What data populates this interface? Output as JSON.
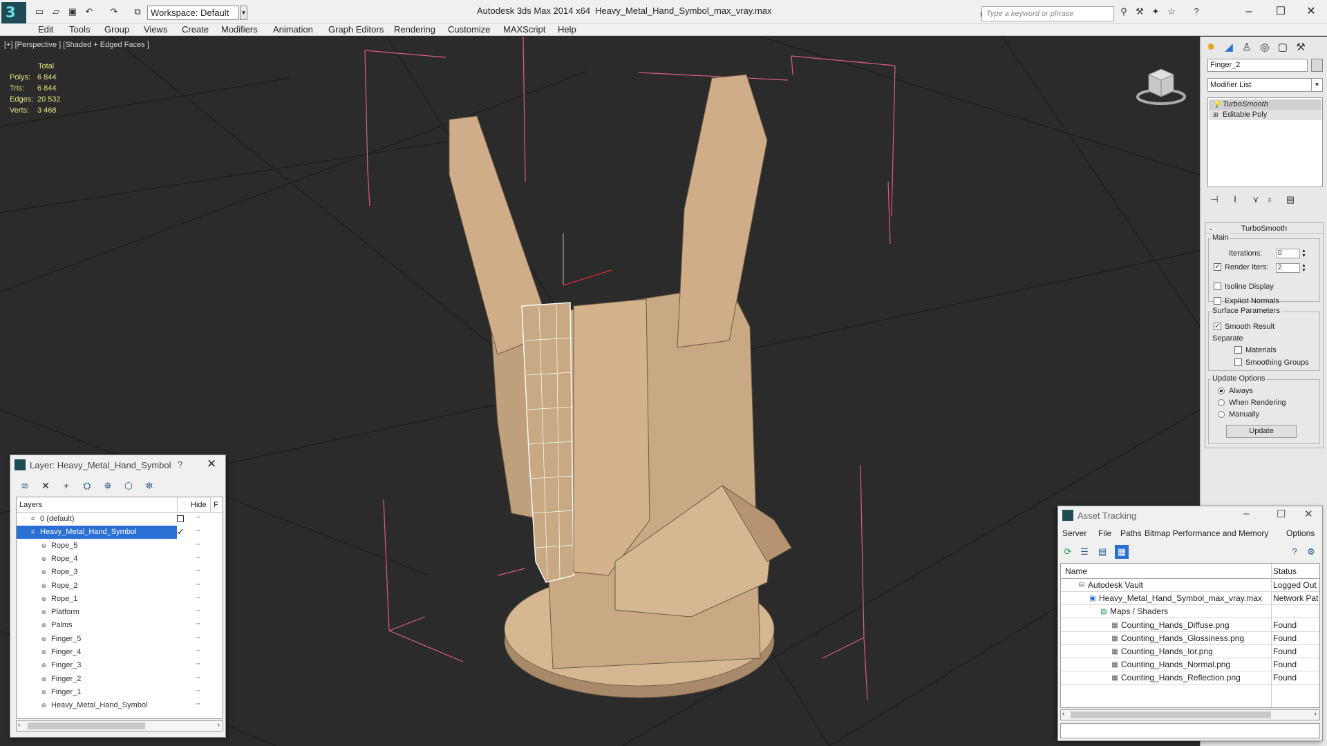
{
  "titlebar": {
    "workspace": "Workspace: Default",
    "app_title": "Autodesk 3ds Max  2014 x64",
    "file_title": "Heavy_Metal_Hand_Symbol_max_vray.max",
    "search_placeholder": "Type a keyword or phrase"
  },
  "menu": [
    "Edit",
    "Tools",
    "Group",
    "Views",
    "Create",
    "Modifiers",
    "Animation",
    "Graph Editors",
    "Rendering",
    "Customize",
    "MAXScript",
    "Help"
  ],
  "viewport": {
    "label": "[+] [Perspective ] [Shaded + Edged Faces ]",
    "stats": {
      "header": "Total",
      "rows": [
        {
          "label": "Polys:",
          "value": "6 844"
        },
        {
          "label": "Tris:",
          "value": "6 844"
        },
        {
          "label": "Edges:",
          "value": "20 532"
        },
        {
          "label": "Verts:",
          "value": "3 468"
        }
      ]
    }
  },
  "command_panel": {
    "object_name": "Finger_2",
    "modifier_list": "Modifier List",
    "stack": [
      "TurboSmooth",
      "Editable Poly"
    ],
    "rollout": {
      "title": "TurboSmooth",
      "main_group": "Main",
      "iterations_label": "Iterations:",
      "iterations_value": "0",
      "render_iters_label": "Render Iters:",
      "render_iters_value": "2",
      "render_iters_checked": true,
      "isoline_label": "Isoline Display",
      "explicit_label": "Explicit Normals",
      "surface_group": "Surface Parameters",
      "smooth_result_label": "Smooth Result",
      "separate_label": "Separate",
      "materials_label": "Materials",
      "smoothing_groups_label": "Smoothing Groups",
      "update_group": "Update Options",
      "always_label": "Always",
      "when_rendering_label": "When Rendering",
      "manually_label": "Manually",
      "update_button": "Update"
    }
  },
  "layer_panel": {
    "title": "Layer: Heavy_Metal_Hand_Symbol",
    "help": "?",
    "col_layers": "Layers",
    "col_hide": "Hide",
    "col_f": "F",
    "rows": [
      {
        "name": "0 (default)",
        "selected": false,
        "indent": 1
      },
      {
        "name": "Heavy_Metal_Hand_Symbol",
        "selected": true,
        "indent": 1
      },
      {
        "name": "Rope_5",
        "selected": false,
        "indent": 2
      },
      {
        "name": "Rope_4",
        "selected": false,
        "indent": 2
      },
      {
        "name": "Rope_3",
        "selected": false,
        "indent": 2
      },
      {
        "name": "Rope_2",
        "selected": false,
        "indent": 2
      },
      {
        "name": "Rope_1",
        "selected": false,
        "indent": 2
      },
      {
        "name": "Platform",
        "selected": false,
        "indent": 2
      },
      {
        "name": "Palms",
        "selected": false,
        "indent": 2
      },
      {
        "name": "Finger_5",
        "selected": false,
        "indent": 2
      },
      {
        "name": "Finger_4",
        "selected": false,
        "indent": 2
      },
      {
        "name": "Finger_3",
        "selected": false,
        "indent": 2
      },
      {
        "name": "Finger_2",
        "selected": false,
        "indent": 2
      },
      {
        "name": "Finger_1",
        "selected": false,
        "indent": 2
      },
      {
        "name": "Heavy_Metal_Hand_Symbol",
        "selected": false,
        "indent": 2
      }
    ]
  },
  "asset_tracking": {
    "title": "Asset Tracking",
    "menu": [
      "Server",
      "File",
      "Paths",
      "Bitmap Performance and Memory",
      "Options"
    ],
    "col_name": "Name",
    "col_status": "Status",
    "rows": [
      {
        "name": "Autodesk Vault",
        "status": "Logged Out",
        "indent": 0
      },
      {
        "name": "Heavy_Metal_Hand_Symbol_max_vray.max",
        "status": "Network Pat",
        "indent": 1
      },
      {
        "name": "Maps / Shaders",
        "status": "",
        "indent": 2
      },
      {
        "name": "Counting_Hands_Diffuse.png",
        "status": "Found",
        "indent": 3
      },
      {
        "name": "Counting_Hands_Glossiness.png",
        "status": "Found",
        "indent": 3
      },
      {
        "name": "Counting_Hands_Ior.png",
        "status": "Found",
        "indent": 3
      },
      {
        "name": "Counting_Hands_Normal.png",
        "status": "Found",
        "indent": 3
      },
      {
        "name": "Counting_Hands_Reflection.png",
        "status": "Found",
        "indent": 3
      }
    ]
  }
}
